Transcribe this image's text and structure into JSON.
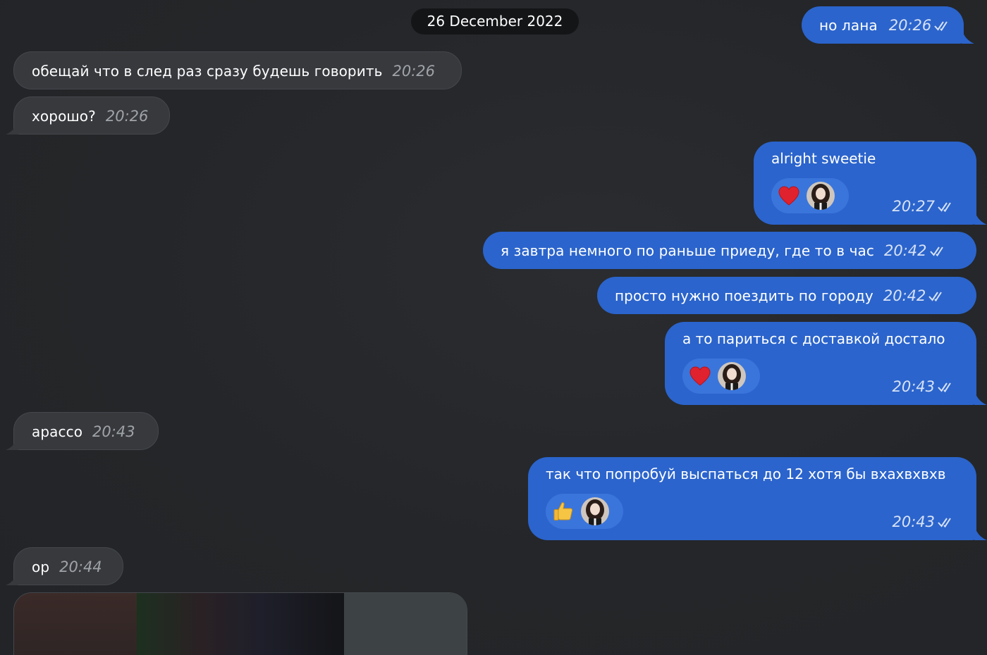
{
  "date_separator": "26 December 2022",
  "messages": [
    {
      "side": "out",
      "text": "но лана",
      "time": "20:26",
      "status": "read"
    },
    {
      "side": "in",
      "text": "обещай что в след раз сразу будешь говорить",
      "time": "20:26"
    },
    {
      "side": "in",
      "text": "хорошо?",
      "time": "20:26"
    },
    {
      "side": "out",
      "text": "alright sweetie",
      "time": "20:27",
      "status": "read",
      "reaction": "heart-icon"
    },
    {
      "side": "out",
      "text": "я завтра немного по раньше приеду, где то в час",
      "time": "20:42",
      "status": "read"
    },
    {
      "side": "out",
      "text": "просто нужно поездить по городу",
      "time": "20:42",
      "status": "read"
    },
    {
      "side": "out",
      "text": "а то париться с доставкой достало",
      "time": "20:43",
      "status": "read",
      "reaction": "heart-icon"
    },
    {
      "side": "in",
      "text": "арассо",
      "time": "20:43"
    },
    {
      "side": "out",
      "text": "так что попробуй выспаться до 12 хотя бы вхахвхвхв",
      "time": "20:43",
      "status": "read",
      "reaction": "thumbs-up-icon"
    },
    {
      "side": "in",
      "text": "ор",
      "time": "20:44"
    }
  ],
  "colors": {
    "background": "#25272a",
    "incoming_bubble": "#37393d",
    "outgoing_bubble": "#2b64cc",
    "reaction_pill": "#3a75dc",
    "date_pill": "#141517"
  }
}
